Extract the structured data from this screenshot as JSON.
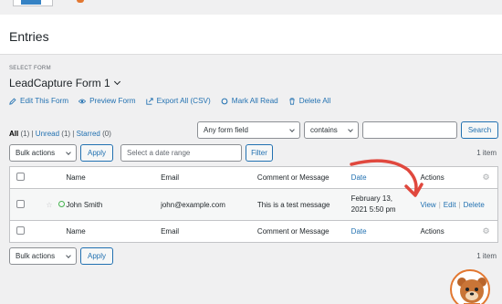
{
  "page": {
    "title": "Entries",
    "select_form_label": "SELECT FORM",
    "selected_form": "LeadCapture Form 1"
  },
  "actions": [
    {
      "label": "Edit This Form",
      "icon": "pencil-icon"
    },
    {
      "label": "Preview Form",
      "icon": "eye-icon"
    },
    {
      "label": "Export All (CSV)",
      "icon": "export-icon"
    },
    {
      "label": "Mark All Read",
      "icon": "circle-icon"
    },
    {
      "label": "Delete All",
      "icon": "trash-icon"
    }
  ],
  "filters": {
    "all": "All",
    "all_count": "(1)",
    "unread": "Unread",
    "unread_count": "(1)",
    "starred": "Starred",
    "starred_count": "(0)",
    "sep": "|"
  },
  "search": {
    "field_select": "Any form field",
    "operator_select": "contains",
    "value": "",
    "button": "Search"
  },
  "bulk": {
    "select": "Bulk actions",
    "apply": "Apply",
    "date_placeholder": "Select a date range",
    "filter": "Filter",
    "items": "1 item"
  },
  "table": {
    "columns": {
      "name": "Name",
      "email": "Email",
      "comment": "Comment or Message",
      "date": "Date",
      "actions": "Actions"
    },
    "rows": [
      {
        "name": "John Smith",
        "email": "john@example.com",
        "comment": "This is a test message",
        "date_line1": "February 13,",
        "date_line2": "2021 5:50 pm",
        "view": "View",
        "edit": "Edit",
        "delete": "Delete"
      }
    ]
  },
  "colors": {
    "accent": "#2271b1",
    "annotation_arrow": "#e0483e",
    "unread_dot": "#46b450"
  }
}
